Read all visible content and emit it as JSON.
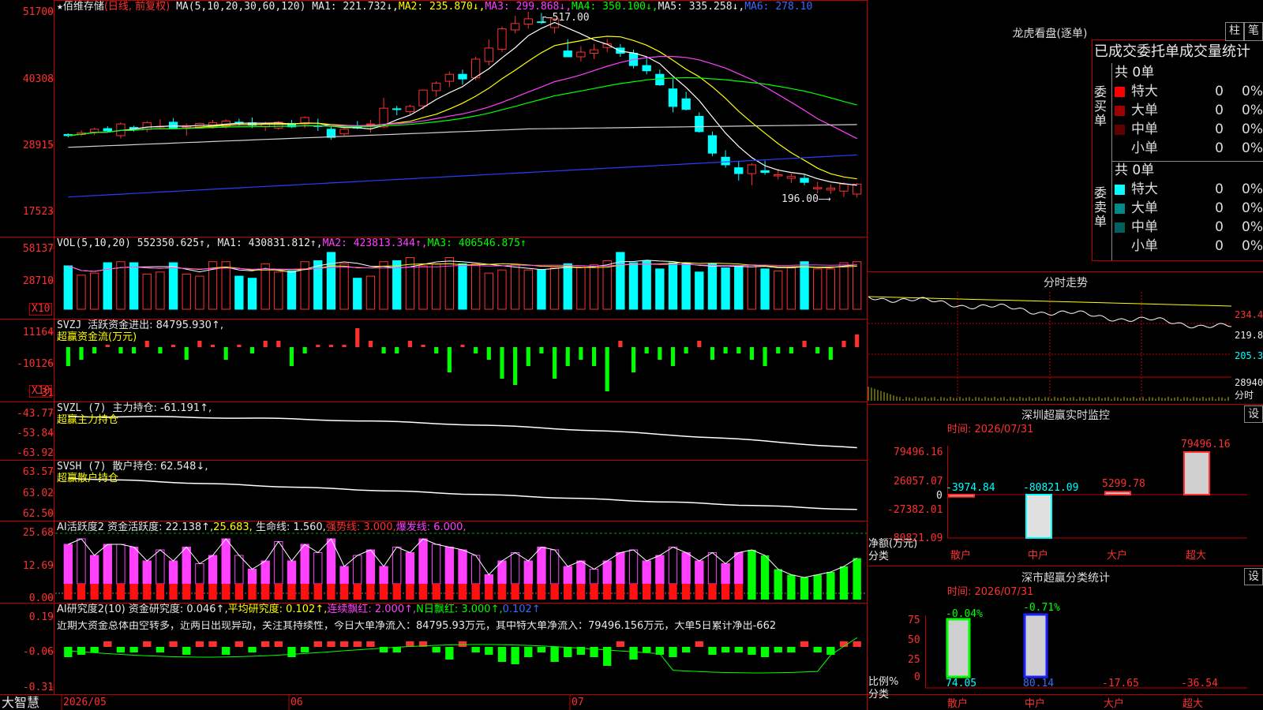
{
  "app": {
    "brand": "大智慧"
  },
  "stock": {
    "name": "佰维存储",
    "period": "(日线, 前复权)",
    "ma_params": "MA(5,10,20,30,60,120)",
    "ma1": "MA1: 221.732↓,",
    "ma2": "MA2: 235.870↓,",
    "ma3": "MA3: 299.868↓,",
    "ma4": "MA4: 350.100↓,",
    "ma5": "MA5: 335.258↓,",
    "ma6": "MA6: 278.10",
    "high_mark": "517.00",
    "low_mark": "196.00",
    "y_labels": [
      "51700",
      "40308",
      "28915",
      "17523"
    ]
  },
  "vol": {
    "title": "VOL(5,10,20)",
    "value": "552350.625↑,",
    "ma1": "MA1: 430831.812↑,",
    "ma2": "MA2: 423813.344↑,",
    "ma3": "MA3: 406546.875↑",
    "y_labels": [
      "58137",
      "28710"
    ],
    "unit": "X10"
  },
  "svzj": {
    "title": "SVZJ",
    "label": "活跃资金进出: 84795.930↑,",
    "sub": "超赢资金流(万元)",
    "y_labels": [
      "11164",
      "-10126",
      "-31"
    ],
    "unit": "X10"
  },
  "svzl": {
    "title": "SVZL (7)",
    "label": "主力持仓: -61.191↑,",
    "sub": "超赢主力持仓",
    "y_labels": [
      "-43.77",
      "-53.84",
      "-63.92"
    ]
  },
  "svsh": {
    "title": "SVSH (7)",
    "label": "散户持仓: 62.548↓,",
    "sub": "超赢散户持仓",
    "y_labels": [
      "63.57",
      "63.02",
      "62.50"
    ]
  },
  "ai1": {
    "title": "AI活跃度2",
    "label": "资金活跃度: 22.138↑,",
    "v2": "25.683,",
    "life": "生命线: 1.560,",
    "strong": "强势线: 3.000,",
    "burst": "爆发线: 6.000,",
    "y_labels": [
      "25.68",
      "12.69",
      "0.00"
    ]
  },
  "ai2": {
    "title": "AI研究度2(10)",
    "label": "资金研究度: 0.046↑,",
    "avg": "平均研究度: 0.102↑,",
    "cont": "连续飘红: 2.000↑,",
    "nday": "N日飘红: 3.000↑,",
    "last": "0.102↑",
    "comment": "近期大资金总体由空转多，近两日出现异动，关注其持续性，今日大单净流入：84795.93万元，其中特大单净流入：79496.156万元，大单5日累计净出-662",
    "y_labels": [
      "0.19",
      "-0.06",
      "-0.31"
    ]
  },
  "dates": [
    "2026/05",
    "06",
    "07"
  ],
  "right": {
    "dragon_title": "龙虎看盘(逐单)",
    "btn_bar": "柱",
    "btn_pen": "笔",
    "order_header": "已成交委托单成交量统计",
    "buy_label": "委买单",
    "sell_label": "委卖单",
    "buy_total": "共 0单",
    "sell_total": "共 0单",
    "buy_rows": [
      {
        "name": "特大",
        "count": "0",
        "pct": "0%",
        "color": "#ff0000"
      },
      {
        "name": "大单",
        "count": "0",
        "pct": "0%",
        "color": "#a00000"
      },
      {
        "name": "中单",
        "count": "0",
        "pct": "0%",
        "color": "#600000"
      },
      {
        "name": "小单",
        "count": "0",
        "pct": "0%",
        "color": "#000000"
      }
    ],
    "sell_rows": [
      {
        "name": "特大",
        "count": "0",
        "pct": "0%",
        "color": "#00ffff"
      },
      {
        "name": "大单",
        "count": "0",
        "pct": "0%",
        "color": "#008a8a"
      },
      {
        "name": "中单",
        "count": "0",
        "pct": "0%",
        "color": "#006060"
      },
      {
        "name": "小单",
        "count": "0",
        "pct": "0%",
        "color": "#000000"
      }
    ],
    "intraday_title": "分时走势",
    "intraday_labels": [
      "234.4",
      "219.8",
      "205.3",
      "28940",
      "分时"
    ],
    "monitor_title": "深圳超赢实时监控",
    "monitor_time": "时间: 2026/07/31",
    "monitor_btn": "设",
    "monitor_y": [
      "79496.16",
      "26057.07",
      "0",
      "-27382.01",
      "-80821.09"
    ],
    "monitor_ylabel": "净额(万元)",
    "monitor_xlabel": "分类",
    "monitor_bars": [
      {
        "cat": "散户",
        "value": -3974.84,
        "label": "-3974.84"
      },
      {
        "cat": "中户",
        "value": -80821.09,
        "label": "-80821.09"
      },
      {
        "cat": "大户",
        "value": 5299.78,
        "label": "5299.78"
      },
      {
        "cat": "超大",
        "value": 79496.16,
        "label": "79496.16"
      }
    ],
    "class_title": "深市超赢分类统计",
    "class_time": "时间: 2026/07/31",
    "class_btn": "设",
    "class_y": [
      "75",
      "50",
      "25",
      "0"
    ],
    "class_ylabel": "比例%",
    "class_xlabel": "分类",
    "class_bars": [
      {
        "cat": "散户",
        "value": 74.05,
        "label": "74.05",
        "top": "-0.04%"
      },
      {
        "cat": "中户",
        "value": 80.14,
        "label": "80.14",
        "top": "-0.71%"
      },
      {
        "cat": "大户",
        "value": -17.65,
        "label": "-17.65",
        "top": ""
      },
      {
        "cat": "超大",
        "value": -36.54,
        "label": "-36.54",
        "top": ""
      }
    ]
  },
  "chart_data": {
    "type": "candlestick",
    "price_unit": "x0.01",
    "candles": [
      [
        307,
        309,
        302,
        305
      ],
      [
        307,
        314,
        304,
        310
      ],
      [
        311,
        318,
        306,
        316
      ],
      [
        317,
        321,
        310,
        313
      ],
      [
        305,
        328,
        300,
        325
      ],
      [
        319,
        322,
        312,
        317
      ],
      [
        316,
        330,
        311,
        327
      ],
      [
        320,
        333,
        316,
        321
      ],
      [
        328,
        335,
        318,
        318
      ],
      [
        319,
        326,
        305,
        322
      ],
      [
        320,
        327,
        317,
        326
      ],
      [
        320,
        332,
        317,
        327
      ],
      [
        321,
        333,
        317,
        330
      ],
      [
        328,
        334,
        322,
        326
      ],
      [
        327,
        336,
        318,
        323
      ],
      [
        320,
        329,
        313,
        326
      ],
      [
        318,
        330,
        315,
        328
      ],
      [
        326,
        332,
        318,
        320
      ],
      [
        325,
        338,
        318,
        336
      ],
      [
        322,
        334,
        313,
        321
      ],
      [
        316,
        322,
        298,
        302
      ],
      [
        308,
        318,
        303,
        316
      ],
      [
        322,
        330,
        316,
        318
      ],
      [
        324,
        332,
        310,
        325
      ],
      [
        320,
        370,
        318,
        352
      ],
      [
        351,
        356,
        340,
        350
      ],
      [
        346,
        358,
        340,
        355
      ],
      [
        356,
        384,
        350,
        383
      ],
      [
        382,
        398,
        372,
        395
      ],
      [
        398,
        415,
        388,
        410
      ],
      [
        410,
        418,
        392,
        402
      ],
      [
        404,
        440,
        400,
        436
      ],
      [
        432,
        470,
        425,
        455
      ],
      [
        453,
        492,
        448,
        488
      ],
      [
        486,
        510,
        480,
        497
      ],
      [
        496,
        517,
        488,
        505
      ],
      [
        500,
        515,
        496,
        499
      ],
      [
        490,
        504,
        480,
        505
      ],
      [
        450,
        470,
        440,
        440
      ],
      [
        440,
        458,
        432,
        448
      ],
      [
        446,
        462,
        436,
        452
      ],
      [
        456,
        470,
        448,
        462
      ],
      [
        455,
        462,
        440,
        446
      ],
      [
        446,
        452,
        420,
        425
      ],
      [
        425,
        440,
        410,
        416
      ],
      [
        410,
        418,
        390,
        392
      ],
      [
        385,
        402,
        345,
        355
      ],
      [
        368,
        380,
        348,
        350
      ],
      [
        338,
        345,
        310,
        312
      ],
      [
        305,
        312,
        270,
        275
      ],
      [
        268,
        280,
        250,
        255
      ],
      [
        250,
        262,
        228,
        240
      ],
      [
        240,
        258,
        220,
        255
      ],
      [
        245,
        262,
        238,
        242
      ],
      [
        236,
        248,
        230,
        238
      ],
      [
        232,
        240,
        224,
        235
      ],
      [
        232,
        238,
        220,
        225
      ],
      [
        214,
        226,
        206,
        216
      ],
      [
        212,
        222,
        205,
        215
      ],
      [
        210,
        225,
        200,
        222
      ],
      [
        205,
        224,
        199,
        222
      ]
    ],
    "volume": [
      42,
      33,
      35,
      45,
      46,
      45,
      34,
      36,
      45,
      34,
      32,
      46,
      46,
      32,
      30,
      44,
      36,
      37,
      46,
      47,
      55,
      44,
      30,
      32,
      46,
      47,
      50,
      42,
      44,
      50,
      44,
      44,
      35,
      38,
      43,
      38,
      38,
      40,
      44,
      41,
      43,
      47,
      55,
      45,
      47,
      39,
      45,
      45,
      36,
      44,
      40,
      42,
      43,
      39,
      37,
      40,
      46,
      39,
      39,
      45,
      46
    ],
    "svzj": [
      -3,
      -2,
      -1,
      0,
      -1,
      -1,
      1,
      -1,
      0,
      -2,
      1,
      0,
      -2,
      0,
      -1,
      1,
      1,
      -3,
      -1,
      0,
      0,
      0,
      3,
      1,
      -1,
      -1,
      1,
      0,
      -1,
      -4,
      0,
      -1,
      -2,
      -5,
      -6,
      -3,
      -1,
      -5,
      -3,
      -2,
      -3,
      -7,
      1,
      -4,
      -1,
      -2,
      -3,
      -1,
      1,
      -2,
      -1,
      -1,
      -2,
      -3,
      -1,
      -1,
      1,
      -1,
      -2,
      1,
      2
    ],
    "activity": [
      20,
      22,
      16,
      20,
      20,
      19,
      14,
      18,
      14,
      19,
      13,
      16,
      22,
      16,
      11,
      14,
      21,
      14,
      20,
      17,
      22,
      12,
      16,
      18,
      12,
      19,
      17,
      22,
      20,
      19,
      18,
      16,
      9,
      14,
      17,
      14,
      19,
      18,
      12,
      14,
      11,
      14,
      17,
      18,
      14,
      16,
      19,
      17,
      14,
      17,
      13,
      17,
      18,
      16,
      11,
      9,
      8,
      9,
      10,
      12,
      15,
      18,
      22
    ]
  }
}
